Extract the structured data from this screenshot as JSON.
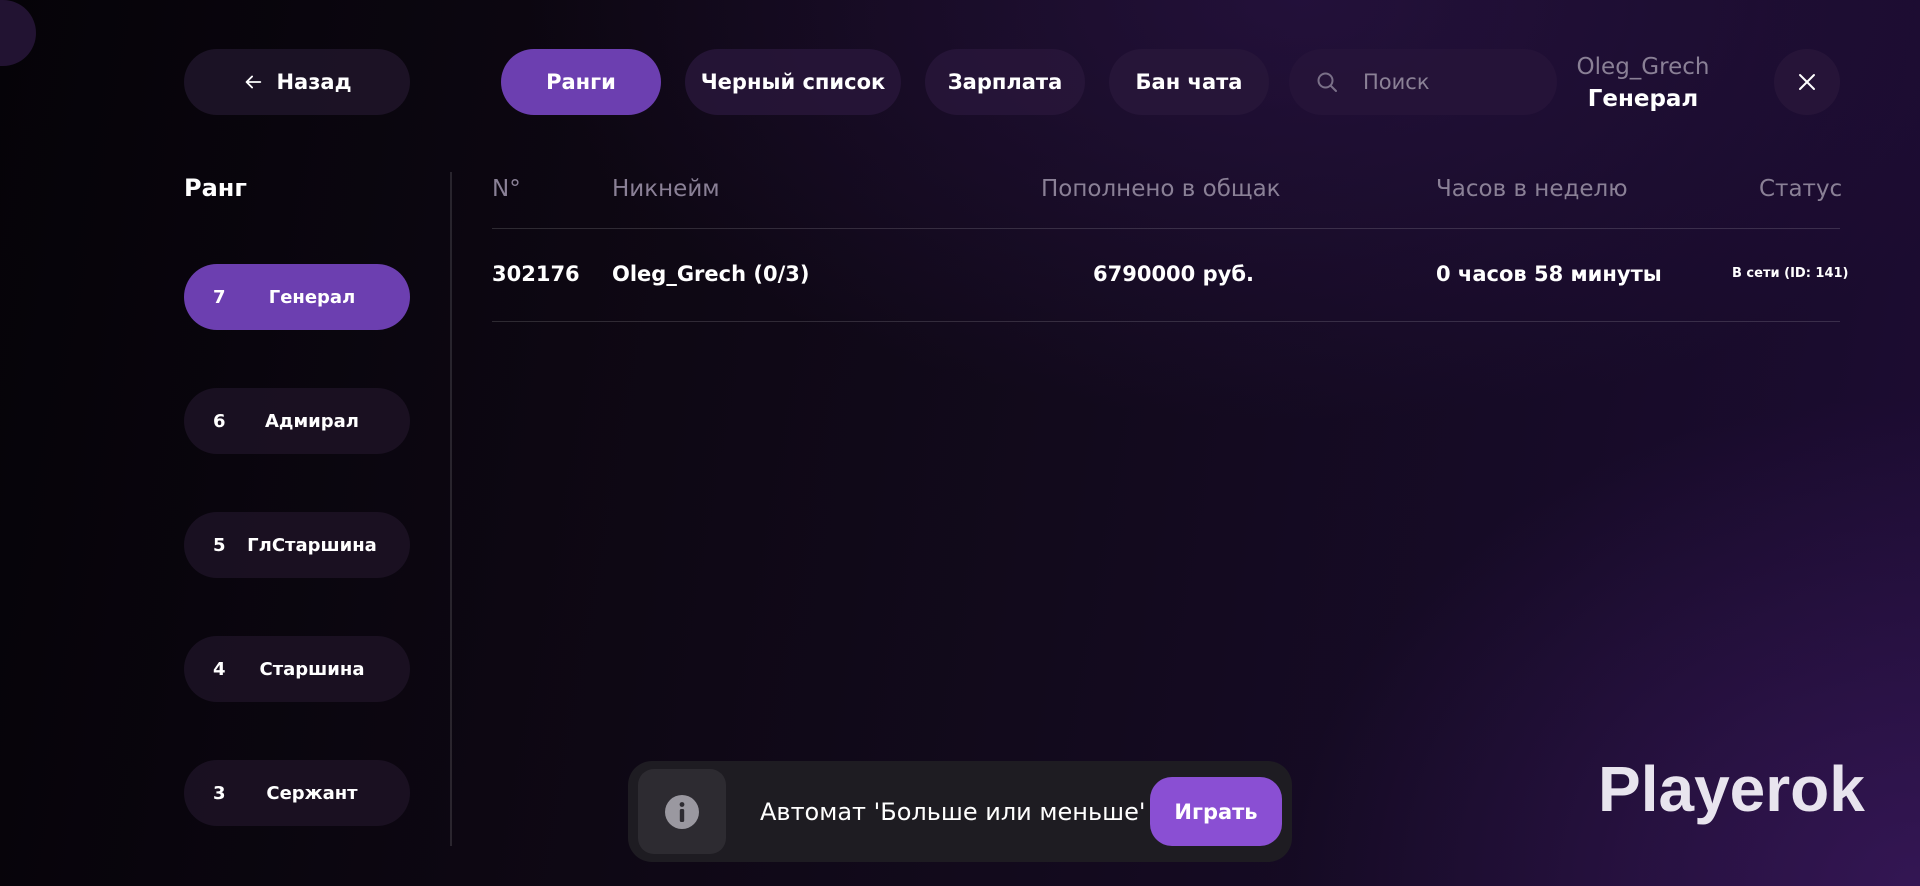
{
  "header": {
    "back_label": "Назад",
    "tabs": [
      {
        "label": "Ранги",
        "active": true
      },
      {
        "label": "Черный список",
        "active": false
      },
      {
        "label": "Зарплата",
        "active": false
      },
      {
        "label": "Бан чата",
        "active": false
      }
    ],
    "search": {
      "placeholder": "Поиск",
      "value": ""
    },
    "user": {
      "name": "Oleg_Grech",
      "rank": "Генерал"
    }
  },
  "sidebar": {
    "title": "Ранг",
    "items": [
      {
        "num": "7",
        "name": "Генерал",
        "active": true
      },
      {
        "num": "6",
        "name": "Адмирал",
        "active": false
      },
      {
        "num": "5",
        "name": "ГлСтаршина",
        "active": false
      },
      {
        "num": "4",
        "name": "Старшина",
        "active": false
      },
      {
        "num": "3",
        "name": "Сержант",
        "active": false
      }
    ]
  },
  "table": {
    "columns": [
      "N°",
      "Никнейм",
      "Пополнено в общак",
      "Часов в неделю",
      "Статус"
    ],
    "rows": [
      {
        "id": "302176",
        "nick": "Oleg_Grech (0/3)",
        "deposited": "6790000 руб.",
        "hours": "0 часов 58 минуты",
        "status": "В сети (ID: 141)"
      }
    ]
  },
  "notification": {
    "text": "Автомат 'Больше или меньше'",
    "action_label": "Играть",
    "icon": "info-icon"
  },
  "logo": {
    "text": "Playerok"
  },
  "colors": {
    "accent": "#6c3fb0",
    "play_button": "#8a4fd3",
    "muted_text": "#8a8096"
  }
}
